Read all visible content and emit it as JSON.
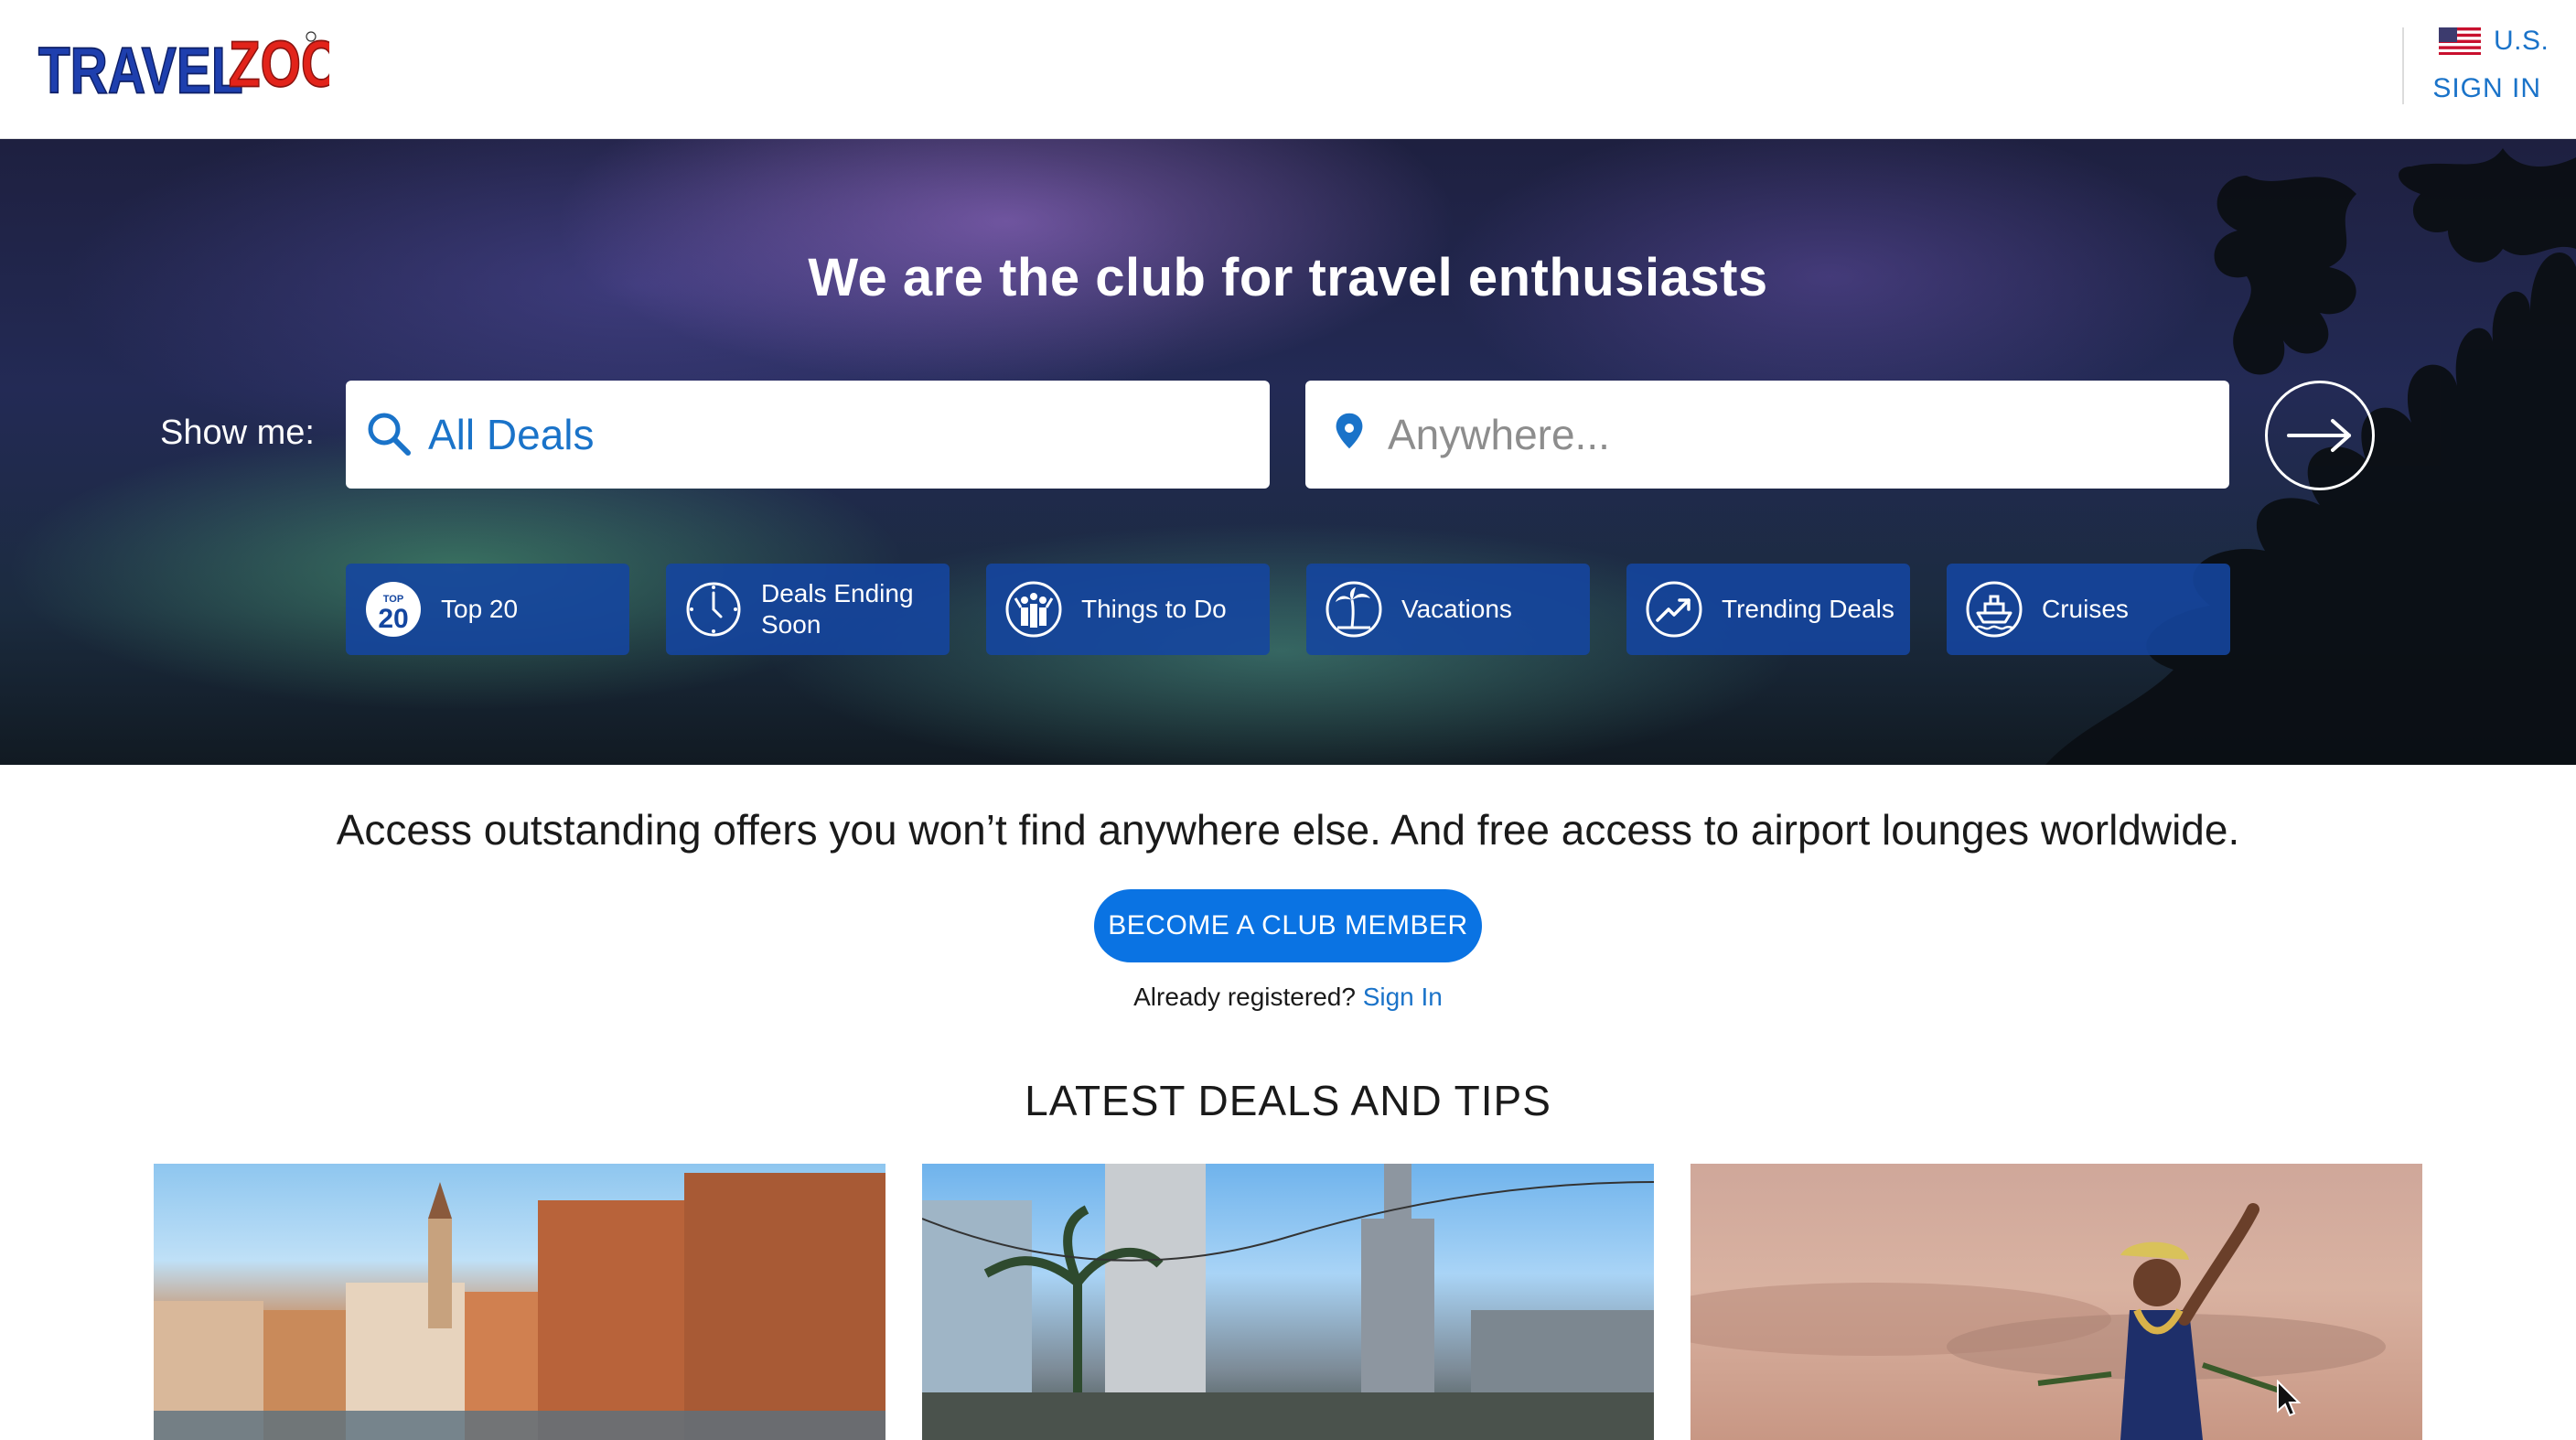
{
  "header": {
    "brand": "TRAVELZOO",
    "region_label": "U.S.",
    "sign_in_label": "SIGN IN",
    "brand_colors": {
      "primary": "#1e3fae",
      "accent": "#e2231a"
    }
  },
  "hero": {
    "title": "We are the club for travel enthusiasts",
    "show_me_label": "Show me:",
    "deal_type_value": "All Deals",
    "location_placeholder": "Anywhere...",
    "chips": [
      {
        "label": "Top 20",
        "icon": "top20-icon"
      },
      {
        "label": "Deals Ending Soon",
        "icon": "clock-icon"
      },
      {
        "label": "Things to Do",
        "icon": "people-icon"
      },
      {
        "label": "Vacations",
        "icon": "palm-tree-icon"
      },
      {
        "label": "Trending Deals",
        "icon": "trending-icon"
      },
      {
        "label": "Cruises",
        "icon": "ship-icon"
      }
    ],
    "top20_badge": {
      "small": "TOP",
      "big": "20"
    }
  },
  "promo": {
    "text": "Access outstanding offers you won’t find anywhere else. And free access to airport lounges worldwide.",
    "cta_label": "BECOME A CLUB MEMBER",
    "registered_prefix": "Already registered?",
    "registered_link": "Sign In"
  },
  "latest": {
    "heading": "LATEST DEALS AND TIPS"
  },
  "colors": {
    "link_blue": "#1a73c9",
    "cta_blue": "#0a73e3",
    "chip_blue": "#1446a0"
  }
}
